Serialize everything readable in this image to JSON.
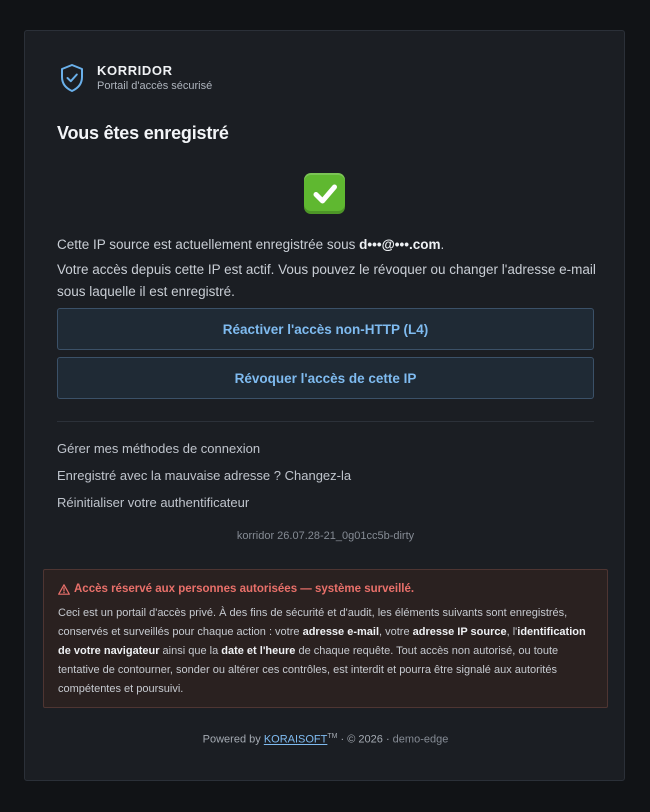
{
  "brand": {
    "name": "KORRIDOR",
    "subtitle": "Portail d'accès sécurisé",
    "icon": "shield-check-icon",
    "accent": "#6ab0ea"
  },
  "page": {
    "title": "Vous êtes enregistré",
    "status_icon": "green-check-icon",
    "status_color": "#5fb830"
  },
  "registration": {
    "line_prefix": "Cette IP source est actuellement enregistrée sous ",
    "email_masked": "d•••@•••.com",
    "line_suffix": ".",
    "description": "Votre accès depuis cette IP est actif. Vous pouvez le révoquer ou changer l'adresse e-mail sous laquelle il est enregistré."
  },
  "actions": {
    "reactivate_label": "Réactiver l'accès non-HTTP (L4)",
    "revoke_label": "Révoquer l'accès de cette IP"
  },
  "links": {
    "manage_methods": "Gérer mes méthodes de connexion",
    "wrong_address": "Enregistré avec la mauvaise adresse ? Changez-la",
    "reset_authenticator": "Réinitialiser votre authentificateur"
  },
  "version": "korridor 26.07.28-21_0g01cc5b-dirty",
  "warning": {
    "icon": "warning-triangle-icon",
    "title": "Accès réservé aux personnes autorisées — système surveillé.",
    "body_1": "Ceci est un portail d'accès privé. À des fins de sécurité et d'audit, les éléments suivants sont enregistrés, conservés et surveillés pour chaque action : votre ",
    "email_term": "adresse e-mail",
    "body_2": ", votre ",
    "ip_term": "adresse IP source",
    "body_3": ", l'",
    "browser_term": "identification de votre navigateur",
    "body_4": " ainsi que la ",
    "datetime_term": "date et l'heure",
    "body_5": " de chaque requête. Tout accès non autorisé, ou toute tentative de contourner, sonder ou altérer ces contrôles, est interdit et pourra être signalé aux autorités compétentes et poursuivi.",
    "color": "#e9706a"
  },
  "footer": {
    "powered_by": "Powered by ",
    "company": "KORAISOFT",
    "trademark": "TM",
    "copyright": " · © 2026 · ",
    "host": "demo-edge"
  }
}
